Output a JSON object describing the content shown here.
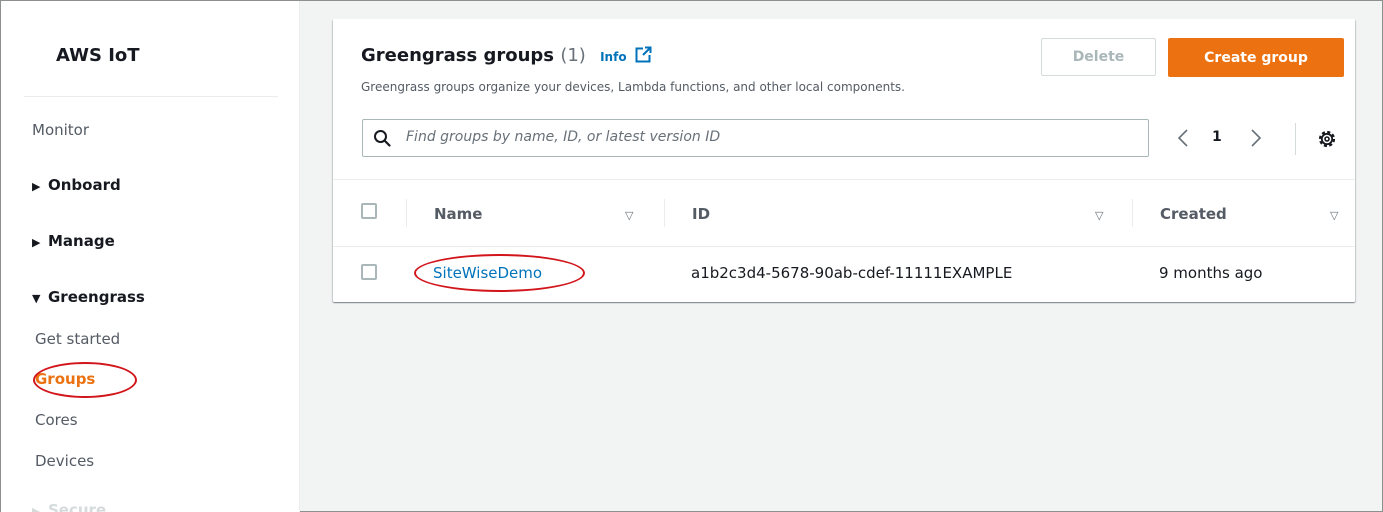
{
  "sidebar": {
    "title": "AWS IoT",
    "items": [
      {
        "label": "Monitor"
      },
      {
        "label": "Onboard"
      },
      {
        "label": "Manage"
      },
      {
        "label": "Greengrass"
      },
      {
        "label": "Get started"
      },
      {
        "label": "Groups"
      },
      {
        "label": "Cores"
      },
      {
        "label": "Devices"
      },
      {
        "label": "Secure"
      }
    ]
  },
  "header": {
    "title": "Greengrass groups",
    "count": "(1)",
    "info": "Info",
    "description": "Greengrass groups organize your devices, Lambda functions, and other local components."
  },
  "actions": {
    "delete_label": "Delete",
    "create_label": "Create group"
  },
  "search": {
    "placeholder": "Find groups by name, ID, or latest version ID"
  },
  "pagination": {
    "page": "1"
  },
  "table": {
    "columns": [
      "Name",
      "ID",
      "Created"
    ],
    "rows": [
      {
        "name": "SiteWiseDemo",
        "id": "a1b2c3d4-5678-90ab-cdef-11111EXAMPLE",
        "created": "9 months ago"
      }
    ]
  },
  "colors": {
    "accent": "#ec7211",
    "link": "#0073bb",
    "annotation": "#d2151b"
  }
}
